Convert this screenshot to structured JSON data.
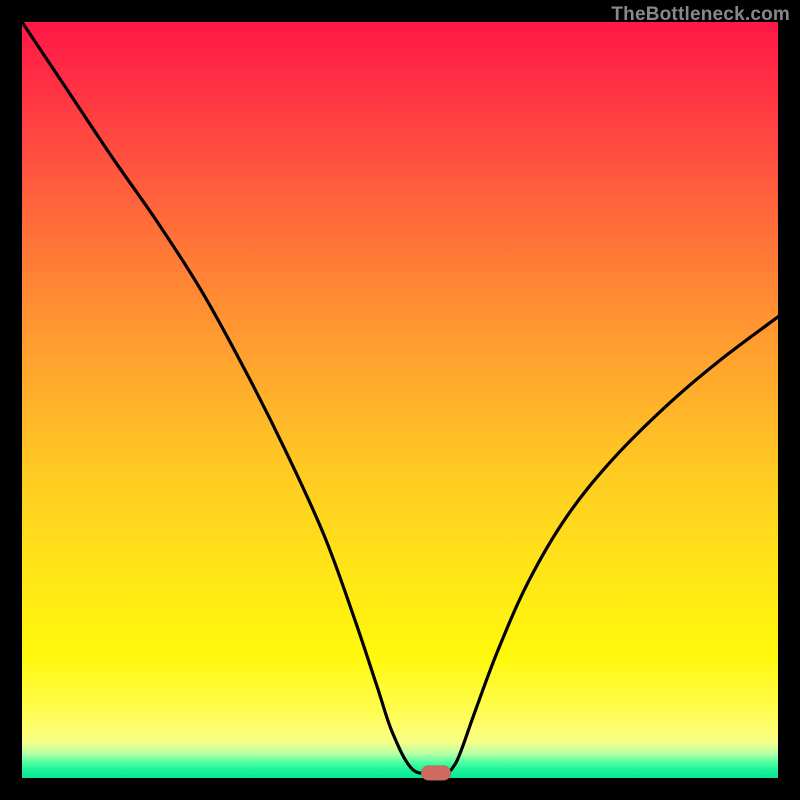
{
  "watermark": "TheBottleneck.com",
  "chart_data": {
    "type": "line",
    "title": "",
    "xlabel": "",
    "ylabel": "",
    "xlim": [
      0,
      100
    ],
    "ylim": [
      0,
      100
    ],
    "grid": false,
    "legend": false,
    "series": [
      {
        "name": "curve",
        "x": [
          0,
          6,
          12,
          18,
          24,
          30,
          35,
          40,
          44,
          47,
          49,
          51.5,
          54,
          56,
          57,
          58,
          60,
          63,
          67,
          72,
          78,
          85,
          92,
          100
        ],
        "values": [
          100,
          91,
          82,
          73.4,
          64,
          53,
          43,
          32,
          21,
          12,
          6,
          1.3,
          0.6,
          0.6,
          1.4,
          3.4,
          9,
          17,
          26,
          34.5,
          42,
          49,
          55,
          61
        ]
      }
    ],
    "marker": {
      "x": 54.8,
      "y": 0.6
    },
    "colors": {
      "gradient_top": "#ff1746",
      "gradient_mid": "#ffe418",
      "gradient_bottom": "#0be695",
      "curve": "#000000",
      "marker": "#cf6a62",
      "frame": "#000000"
    }
  }
}
